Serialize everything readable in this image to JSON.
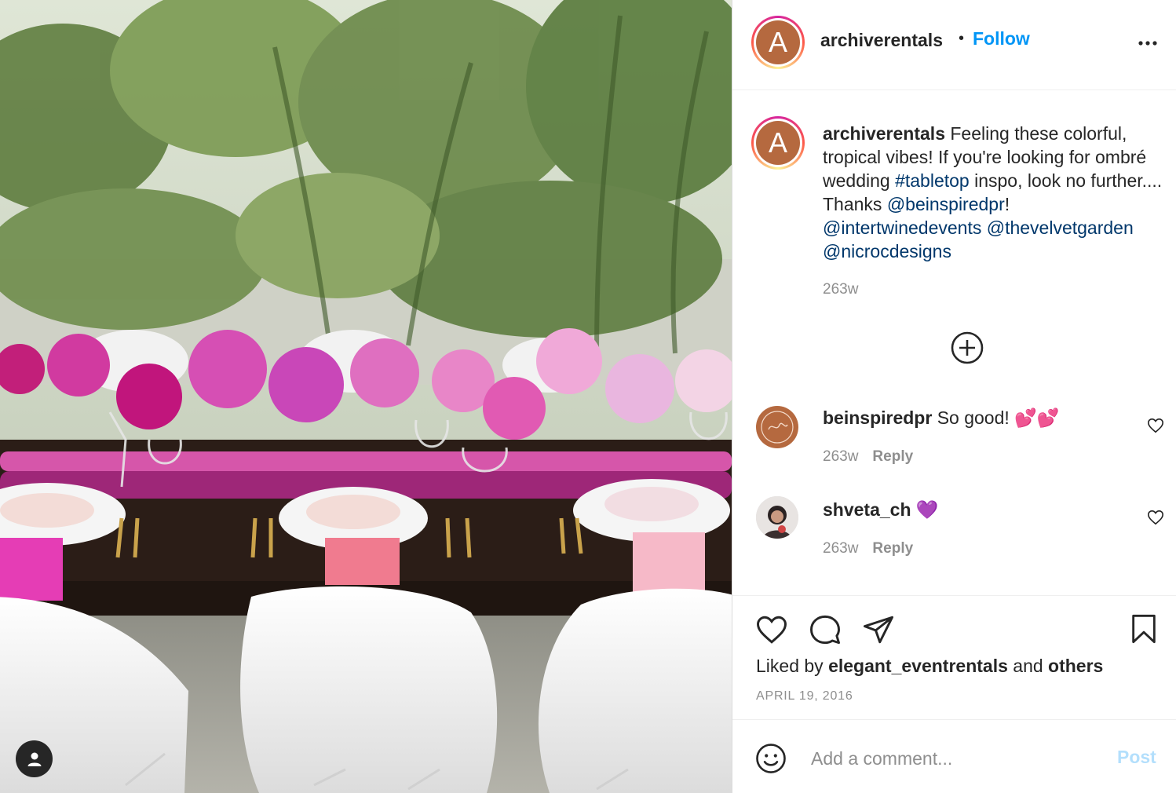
{
  "post": {
    "username": "archiverentals",
    "avatar_letter": "A",
    "follow_label": "Follow",
    "separator": "•",
    "caption": {
      "username": "archiverentals",
      "text_1": " Feeling these colorful, tropical vibes! If you're looking for ombré wedding ",
      "hashtag": "#tabletop",
      "text_2": " inspo, look no further.... Thanks ",
      "mention_1": "@beinspiredpr",
      "text_3": "! ",
      "mention_2": "@intertwinedevents",
      "mention_3": "@thevelvetgarden",
      "mention_4": "@nicrocdesigns",
      "time": "263w"
    },
    "comments": [
      {
        "username": "beinspiredpr",
        "text": "So good! 💕💕",
        "time": "263w",
        "reply_label": "Reply"
      },
      {
        "username": "shveta_ch",
        "text": "💜",
        "time": "263w",
        "reply_label": "Reply"
      }
    ],
    "likes": {
      "prefix": "Liked by ",
      "user": "elegant_eventrentals",
      "middle": " and ",
      "others": "others"
    },
    "date": "APRIL 19, 2016",
    "comment_placeholder": "Add a comment...",
    "post_label": "Post"
  },
  "icons": {
    "more": "more-options-icon",
    "load_more": "plus-circle-icon",
    "like": "heart-icon",
    "comment": "comment-icon",
    "share": "paper-plane-icon",
    "save": "bookmark-icon",
    "emoji": "smiley-icon",
    "user_tag": "person-icon"
  },
  "colors": {
    "follow": "#0095f6",
    "link": "#00376b",
    "post_disabled": "#b3dffc",
    "avatar_bg": "#b5693f"
  }
}
